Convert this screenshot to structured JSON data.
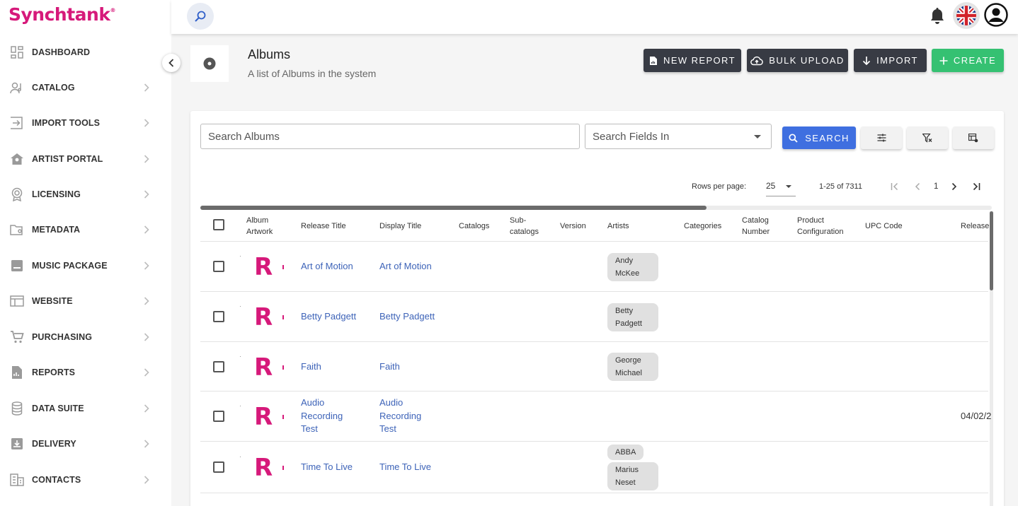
{
  "app": {
    "name": "Synchtank",
    "brand_color": "#d6197a"
  },
  "sidebar": {
    "items": [
      {
        "label": "DASHBOARD",
        "icon": "dashboard-icon",
        "has_chevron": false
      },
      {
        "label": "CATALOG",
        "icon": "catalog-icon",
        "has_chevron": true
      },
      {
        "label": "IMPORT TOOLS",
        "icon": "import-tools-icon",
        "has_chevron": true
      },
      {
        "label": "ARTIST PORTAL",
        "icon": "artist-portal-icon",
        "has_chevron": true
      },
      {
        "label": "LICENSING",
        "icon": "licensing-icon",
        "has_chevron": true
      },
      {
        "label": "METADATA",
        "icon": "metadata-icon",
        "has_chevron": true
      },
      {
        "label": "MUSIC PACKAGE",
        "icon": "music-package-icon",
        "has_chevron": true
      },
      {
        "label": "WEBSITE",
        "icon": "website-icon",
        "has_chevron": true
      },
      {
        "label": "PURCHASING",
        "icon": "cart-icon",
        "has_chevron": true
      },
      {
        "label": "REPORTS",
        "icon": "reports-icon",
        "has_chevron": true
      },
      {
        "label": "DATA SUITE",
        "icon": "database-icon",
        "has_chevron": true
      },
      {
        "label": "DELIVERY",
        "icon": "delivery-icon",
        "has_chevron": true
      },
      {
        "label": "CONTACTS",
        "icon": "contacts-icon",
        "has_chevron": true
      }
    ]
  },
  "header": {
    "title": "Albums",
    "subtitle": "A list of Albums in the system",
    "buttons": {
      "new_report": "NEW REPORT",
      "bulk_upload": "BULK UPLOAD",
      "import": "IMPORT",
      "create": "CREATE"
    }
  },
  "search": {
    "placeholder": "Search Albums",
    "fields_placeholder": "Search Fields In",
    "button": "SEARCH"
  },
  "pagination": {
    "rows_label": "Rows per page:",
    "rows_value": "25",
    "range": "1-25 of 7311",
    "page": "1"
  },
  "table": {
    "columns": {
      "album_artwork": "Album Artwork",
      "release_title": "Release Title",
      "display_title": "Display Title",
      "catalogs": "Catalogs",
      "subcatalogs": "Sub-catalogs",
      "version": "Version",
      "artists": "Artists",
      "categories": "Categories",
      "catalog_number": "Catalog Number",
      "product_configuration": "Product Configuration",
      "upc_code": "UPC Code",
      "release": "Release"
    },
    "rows": [
      {
        "release_title": "Art of Motion",
        "display_title": "Art of Motion",
        "artists": [
          "Andy McKee"
        ],
        "release_date": ""
      },
      {
        "release_title": "Betty Padgett",
        "display_title": "Betty Padgett",
        "artists": [
          "Betty Padgett"
        ],
        "release_date": ""
      },
      {
        "release_title": "Faith",
        "display_title": "Faith",
        "artists": [
          "George Michael"
        ],
        "release_date": ""
      },
      {
        "release_title": "Audio Recording Test",
        "display_title": "Audio Recording Test",
        "artists": [],
        "release_date": "04/02/2"
      },
      {
        "release_title": "Time To Live",
        "display_title": "Time To Live",
        "artists": [
          "ABBA",
          "Marius Neset"
        ],
        "release_date": ""
      }
    ]
  },
  "colors": {
    "dark_button": "#383b44",
    "create_button": "#35c172",
    "search_button": "#3f6fe0",
    "link": "#3d63b8"
  }
}
